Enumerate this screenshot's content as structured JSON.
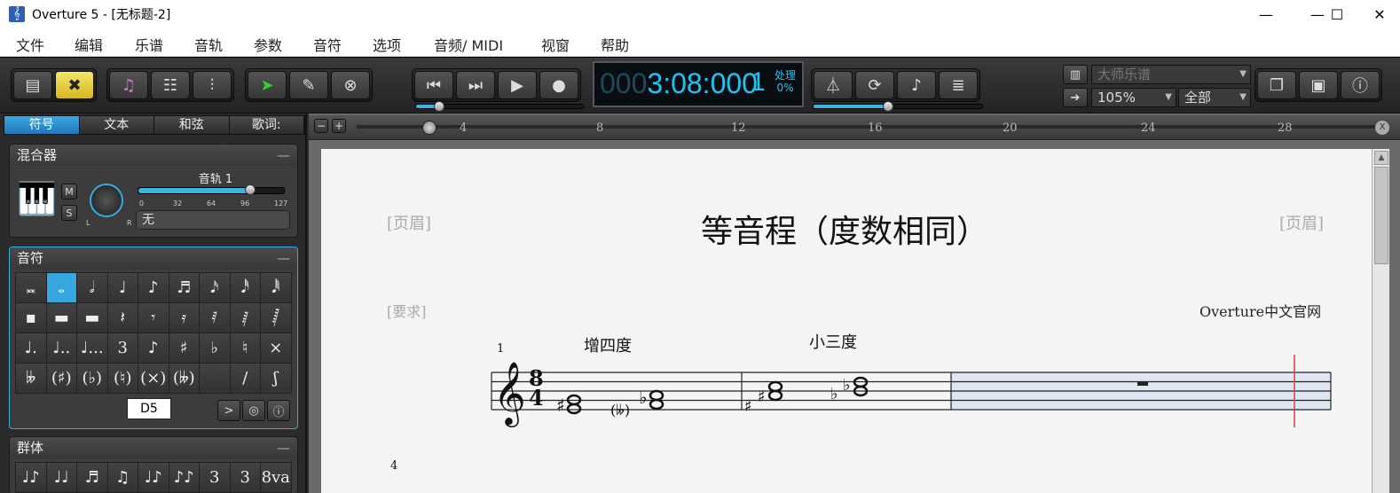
{
  "window": {
    "title": "Overture 5 - [无标题-2]",
    "app_icon_glyph": "𝄞",
    "minimize": "—",
    "maximize": "☐",
    "close": "✕"
  },
  "menu": [
    "文件",
    "编辑",
    "乐谱",
    "音轨",
    "参数",
    "音符",
    "选项",
    "音频/ MIDI",
    "视窗",
    "帮助"
  ],
  "transport": {
    "time_dim": "000",
    "time": "3:08:000",
    "counter": "1",
    "processing_label": "处理",
    "processing_pct": "0%"
  },
  "toolbar_right": {
    "score_type": "大师乐谱",
    "zoom": "105%",
    "view_scope": "全部"
  },
  "tabs": [
    "符号",
    "文本",
    "和弦",
    "歌词:"
  ],
  "mixer": {
    "title": "混合器",
    "mute": "M",
    "solo": "S",
    "track_name": "音轨 1",
    "volume_pct": 76,
    "ticks": [
      "0",
      "32",
      "64",
      "96",
      "127"
    ],
    "pan_left": "L",
    "pan_right": "R",
    "instrument": "无"
  },
  "notes_panel": {
    "title": "音符",
    "cells": [
      "𝅜",
      "𝅝",
      "𝅗𝅥",
      "♩",
      "♪",
      "♬",
      "𝅘𝅥𝅯",
      "𝅘𝅥𝅰",
      "𝅘𝅥𝅱",
      "▪",
      "▬",
      "▬",
      "𝄽",
      "𝄾",
      "𝄿",
      "𝅀",
      "𝅁",
      "𝅂",
      "♩.",
      "♩..",
      "♩...",
      "3",
      "♪",
      "♯",
      "♭",
      "♮",
      "×",
      "𝄫",
      "(♯)",
      "(♭)",
      "(♮)",
      "(×)",
      "(𝄫)",
      "",
      "/",
      "ʃ"
    ],
    "pitch_label": "D5"
  },
  "groups_panel": {
    "title": "群体",
    "cells": [
      "♩♪",
      "♩♩",
      "♬",
      "♫",
      "♩♪",
      "♪♪",
      "3",
      "3",
      "8va"
    ]
  },
  "ruler": {
    "marks": [
      "4",
      "8",
      "12",
      "16",
      "20",
      "24",
      "28"
    ]
  },
  "score": {
    "header_left": "[页眉]",
    "header_right": "[页眉]",
    "title": "等音程（度数相同）",
    "request": "[要求]",
    "composer": "Overture中文官网",
    "measure_num_1": "1",
    "measure_num_4": "4",
    "time_sig_top": "8",
    "time_sig_bottom": "4",
    "label_aug4": "增四度",
    "label_min3": "小三度"
  },
  "colors": {
    "accent": "#3aa8e2",
    "lcd_text": "#22c4ef",
    "playhead": "#d94040"
  }
}
